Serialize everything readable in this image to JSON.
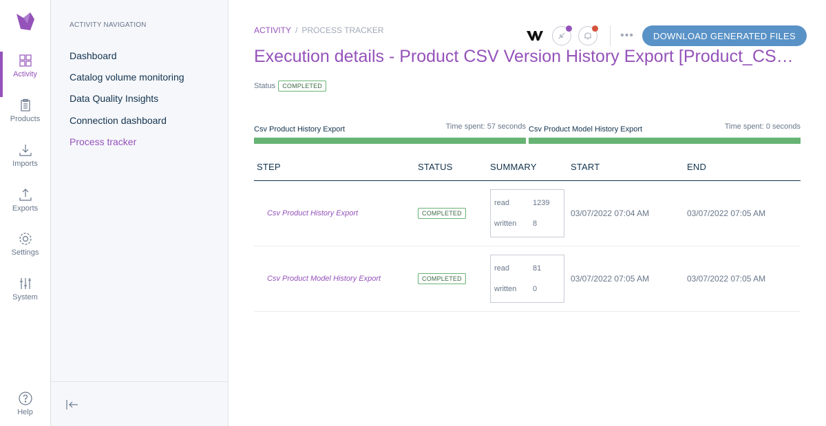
{
  "menu": {
    "items": [
      {
        "label": "Activity",
        "icon": "activity-icon",
        "active": true
      },
      {
        "label": "Products",
        "icon": "products-icon"
      },
      {
        "label": "Imports",
        "icon": "imports-icon"
      },
      {
        "label": "Exports",
        "icon": "exports-icon"
      },
      {
        "label": "Settings",
        "icon": "settings-icon"
      },
      {
        "label": "System",
        "icon": "system-icon"
      }
    ],
    "help": "Help"
  },
  "subnav": {
    "title": "ACTIVITY NAVIGATION",
    "items": [
      "Dashboard",
      "Catalog volume monitoring",
      "Data Quality Insights",
      "Connection dashboard",
      "Process tracker"
    ],
    "active_index": 4
  },
  "breadcrumb": {
    "root": "ACTIVITY",
    "separator": "/",
    "current": "PROCESS TRACKER"
  },
  "header": {
    "download_label": "DOWNLOAD GENERATED FILES",
    "more": "•••"
  },
  "title": "Execution details - Product CSV Version History Export [Product_CSV_Version_History_Export]",
  "status": {
    "label": "Status",
    "value": "COMPLETED"
  },
  "progress": [
    {
      "label": "Csv Product History Export",
      "time": "Time spent: 57 seconds",
      "percent": 100
    },
    {
      "label": "Csv Product Model History Export",
      "time": "Time spent: 0 seconds",
      "percent": 100
    }
  ],
  "table": {
    "headers": [
      "STEP",
      "STATUS",
      "SUMMARY",
      "START",
      "END"
    ],
    "rows": [
      {
        "step": "Csv Product History Export",
        "status": "COMPLETED",
        "summary": [
          {
            "k": "read",
            "v": "1239"
          },
          {
            "k": "written",
            "v": "8"
          }
        ],
        "start": "03/07/2022 07:04 AM",
        "end": "03/07/2022 07:05 AM"
      },
      {
        "step": "Csv Product Model History Export",
        "status": "COMPLETED",
        "summary": [
          {
            "k": "read",
            "v": "81"
          },
          {
            "k": "written",
            "v": "0"
          }
        ],
        "start": "03/07/2022 07:05 AM",
        "end": "03/07/2022 07:05 AM"
      }
    ]
  },
  "colors": {
    "accent": "#9452ba",
    "success": "#67b373",
    "button": "#5992c7"
  }
}
